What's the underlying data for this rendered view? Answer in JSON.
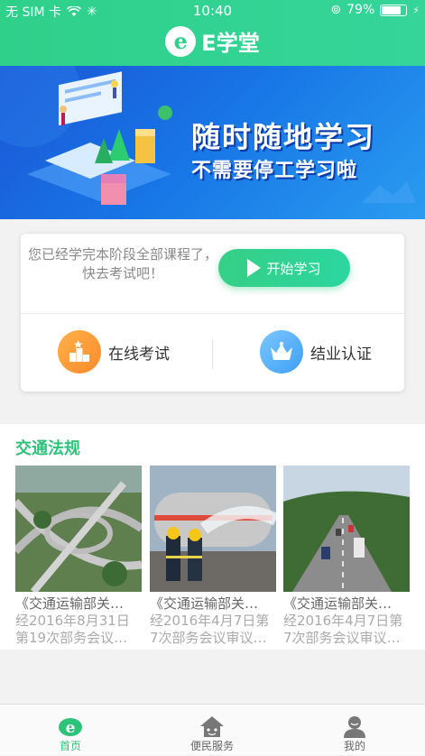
{
  "status_bar": {
    "carrier": "无 SIM 卡",
    "time": "10:40",
    "battery": "79%",
    "battery_level": 0.79
  },
  "header": {
    "logo_letter": "e",
    "title": "E学堂"
  },
  "banner": {
    "title": "随时随地学习",
    "subtitle": "不需要停工学习啦"
  },
  "card": {
    "message": "您已经学完本阶段全部课程了，快去考试吧！",
    "start_button": "开始学习",
    "actions": [
      {
        "label": "在线考试",
        "icon": "trophy-podium-icon",
        "color": "#ff9a36"
      },
      {
        "label": "结业认证",
        "icon": "crown-icon",
        "color": "#4aa8f7"
      }
    ]
  },
  "section": {
    "title": "交通法规",
    "items": [
      {
        "title": "《交通运输部关…",
        "desc": "经2016年8月31日第19次部务会议…",
        "image": "highway-interchange-photo"
      },
      {
        "title": "《交通运输部关…",
        "desc": "经2016年4月7日第7次部务会议审议…",
        "image": "firefighters-tanker-photo"
      },
      {
        "title": "《交通运输部关…",
        "desc": "经2016年4月7日第7次部务会议审议…",
        "image": "highway-traffic-photo"
      }
    ]
  },
  "tabbar": {
    "tabs": [
      {
        "label": "首页",
        "icon": "home-e-icon",
        "active": true
      },
      {
        "label": "便民服务",
        "icon": "house-service-icon",
        "active": false
      },
      {
        "label": "我的",
        "icon": "user-profile-icon",
        "active": false
      }
    ]
  },
  "colors": {
    "brand_green": "#2fd08a",
    "banner_blue": "#1a6fe0",
    "section_title": "#2fc27a"
  }
}
